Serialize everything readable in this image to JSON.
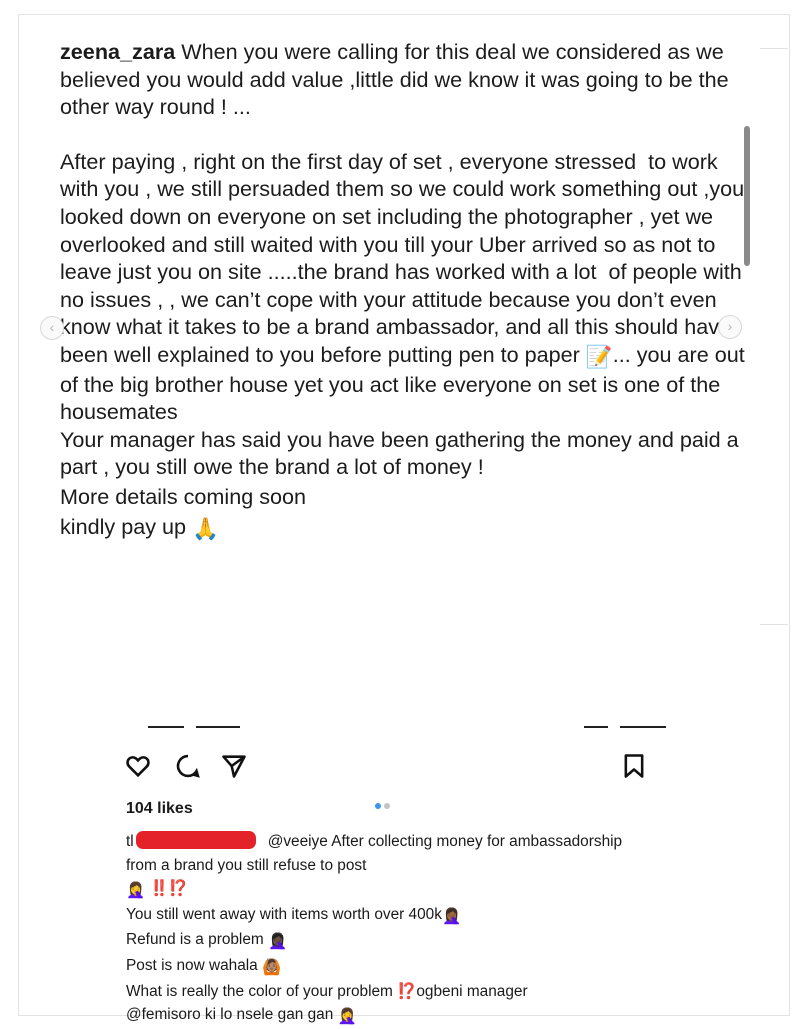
{
  "caption": {
    "username": "zeena_zara",
    "lead": " When you were calling for this deal we considered as we believed you would add value ,little did we know it was going to be the other way round ! ...",
    "para_a": "After paying , right on the first day of set , everyone stressed  to work with you , we still persuaded them so we could work something out ,you looked down on everyone on set including the photographer , yet we overlooked and still waited with you till your Uber arrived so as not to leave just you on site .....the brand has worked with a lot  of people with no issues , , we can’t cope with your attitude because you don’t even know what it takes to be a brand ambassador, and all this should have been well explained to you before putting pen to paper ",
    "para_a_emoji": "📝",
    "para_a_end": "... you are out of the big brother house yet you act like everyone on set is one of the housemates",
    "line_manager": "Your manager has said you have been gathering the money and paid a part , you still owe the brand a lot of money !",
    "line_details": "More details coming soon",
    "line_pay": "kindly pay up ",
    "line_pay_emoji": "🙏"
  },
  "post": {
    "likes": "104 likes",
    "comment": {
      "user_initial": "tl",
      "mention": "@veeiye",
      "text1": " After collecting money for ambassadorship from a brand you still refuse to post",
      "line2_emoji": "🤦‍♀️",
      "line2_marks": " ‼️⁉️",
      "line3": "You still went away with items worth over 400k",
      "line3_emoji": "🤦🏾‍♀️",
      "line4": "Refund is a problem ",
      "line4_emoji": "🤦🏿‍♀️",
      "line5": "Post is now wahala ",
      "line5_emoji": "🙆🏽",
      "line6": "What is really the color of your problem ",
      "line6_marks": "⁉️",
      "line6_end": "ogbeni manager",
      "line7_mention": "@femisoro",
      "line7": " ki lo nsele gan gan ",
      "line7_emoji": "🤦‍♀️"
    }
  },
  "icons": {
    "like": "heart-icon",
    "comment": "comment-icon",
    "share": "send-icon",
    "save": "bookmark-icon",
    "prev": "chevron-left-icon",
    "next": "chevron-right-icon"
  },
  "colors": {
    "redaction": "#e4222a",
    "carousel_active": "#3897f0",
    "carousel_inactive": "#c4c4c4"
  }
}
